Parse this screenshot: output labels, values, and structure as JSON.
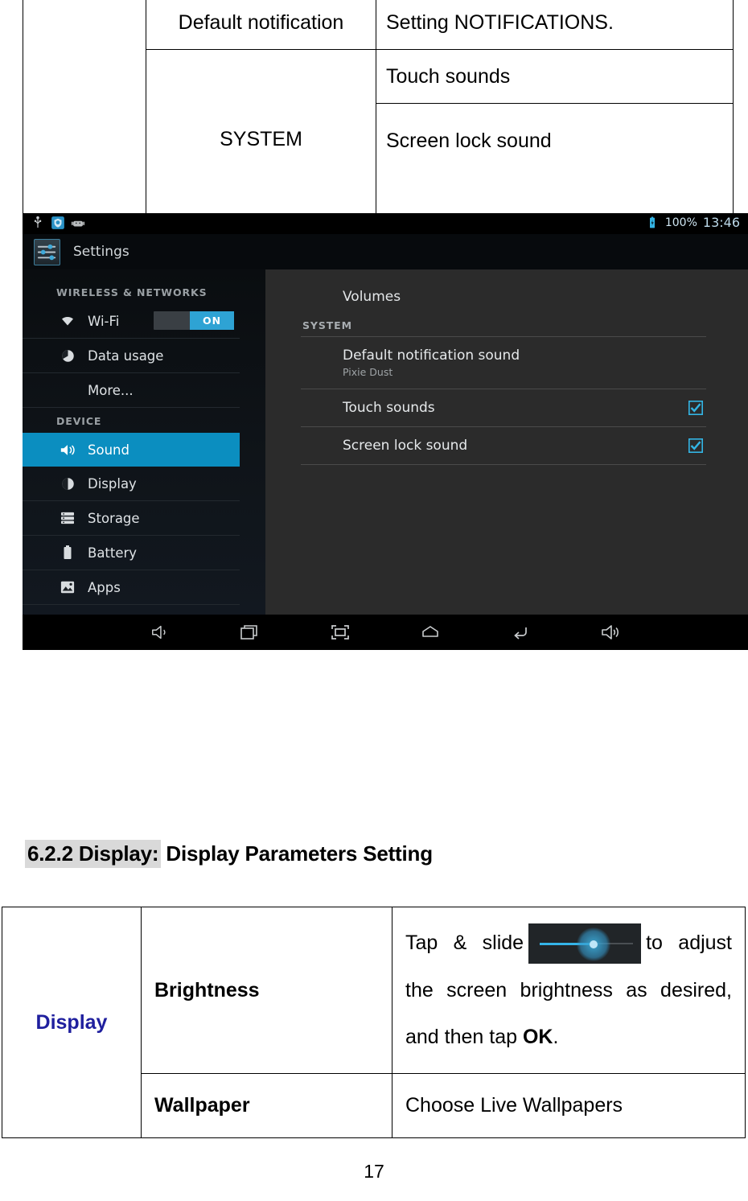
{
  "sound_table": {
    "rows": [
      {
        "category": "",
        "item": "Default notification",
        "desc": "Setting NOTIFICATIONS."
      },
      {
        "category": "SYSTEM",
        "item": "",
        "desc": "Touch sounds"
      },
      {
        "category": "",
        "item": "",
        "desc": "Screen lock sound"
      }
    ]
  },
  "heading": {
    "number_label": "6.2.2 Display:",
    "title": "Display Parameters Setting"
  },
  "display_table": {
    "category": "Display",
    "rows": [
      {
        "item": "Brightness",
        "desc_before": "Tap & slide",
        "desc_after": "to adjust the screen brightness as desired, and then tap",
        "desc_bold": "OK",
        "desc_end": "."
      },
      {
        "item": "Wallpaper",
        "desc": "Choose Live Wallpapers"
      }
    ]
  },
  "page_number": "17",
  "screenshot": {
    "status_bar": {
      "usb_icon": "usb-icon",
      "shield_icon": "shield-clock-icon",
      "android_icon": "android-robot-icon",
      "battery_icon": "battery-full-icon",
      "battery_percent": "100%",
      "clock": "13:46"
    },
    "action_bar": {
      "app_icon": "settings-sliders-icon",
      "title": "Settings"
    },
    "sidebar": {
      "groups": [
        {
          "label": "WIRELESS & NETWORKS",
          "items": [
            {
              "label": "Wi-Fi",
              "icon": "wifi-icon",
              "toggle": "ON",
              "selected": false
            },
            {
              "label": "Data usage",
              "icon": "data-usage-icon",
              "selected": false
            },
            {
              "label": "More...",
              "icon": "",
              "selected": false,
              "indent": true
            }
          ]
        },
        {
          "label": "DEVICE",
          "items": [
            {
              "label": "Sound",
              "icon": "sound-icon",
              "selected": true
            },
            {
              "label": "Display",
              "icon": "display-icon",
              "selected": false
            },
            {
              "label": "Storage",
              "icon": "storage-icon",
              "selected": false
            },
            {
              "label": "Battery",
              "icon": "battery-icon",
              "selected": false
            },
            {
              "label": "Apps",
              "icon": "apps-icon",
              "selected": false
            }
          ]
        }
      ]
    },
    "detail": {
      "title": "Volumes",
      "group_label": "SYSTEM",
      "rows": [
        {
          "main": "Default notification sound",
          "sub": "Pixie Dust",
          "checked": false
        },
        {
          "main": "Touch sounds",
          "sub": "",
          "checked": true
        },
        {
          "main": "Screen lock sound",
          "sub": "",
          "checked": true
        }
      ]
    },
    "nav_bar": {
      "buttons": [
        "volume-down-icon",
        "recent-apps-icon",
        "screenshot-icon",
        "home-icon",
        "back-icon",
        "volume-up-icon"
      ]
    },
    "colors": {
      "accent": "#0b8ec0",
      "panel_dark": "#0c1015",
      "panel_light": "#2b2b2b",
      "check_blue": "#33b5e5"
    }
  }
}
